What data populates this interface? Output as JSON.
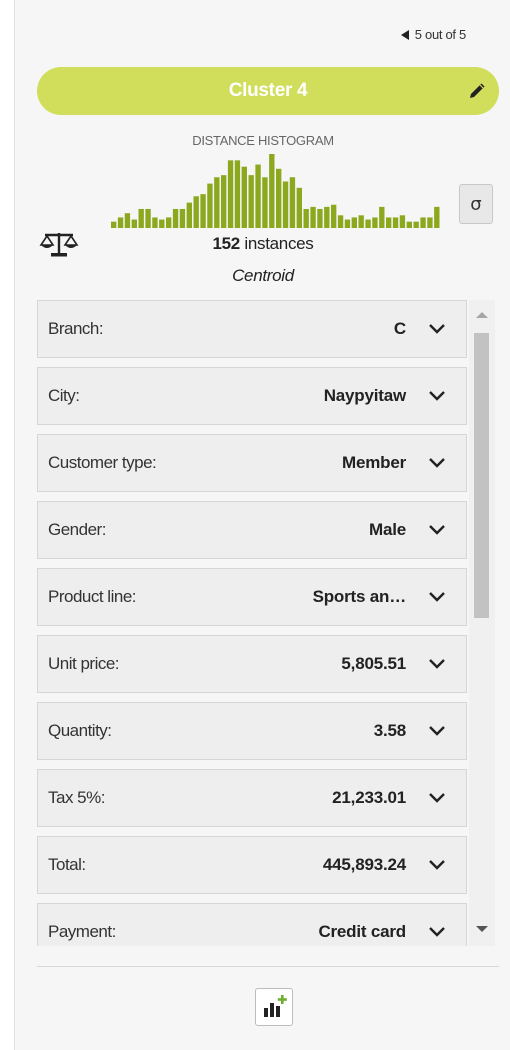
{
  "pager": {
    "text": "5 out of 5"
  },
  "cluster": {
    "title": "Cluster 4",
    "color": "#d0de5b"
  },
  "histogram": {
    "label": "DISTANCE HISTOGRAM",
    "bar_color": "#8ca81e",
    "bins": [
      3,
      5,
      7,
      4,
      9,
      9,
      5,
      4,
      5,
      9,
      9,
      12,
      15,
      16,
      21,
      24,
      25,
      32,
      32,
      29,
      25,
      30,
      24,
      35,
      28,
      22,
      24,
      19,
      9,
      10,
      9,
      10,
      11,
      6,
      4,
      5,
      6,
      4,
      5,
      10,
      5,
      5,
      6,
      3,
      3,
      5,
      5,
      10
    ]
  },
  "sigma": {
    "label": "σ"
  },
  "summary": {
    "count": "152",
    "instances_label": "instances",
    "subtitle": "Centroid"
  },
  "fields": [
    {
      "label": "Branch:",
      "value": "C"
    },
    {
      "label": "City:",
      "value": "Naypyitaw"
    },
    {
      "label": "Customer type:",
      "value": "Member"
    },
    {
      "label": "Gender:",
      "value": "Male"
    },
    {
      "label": "Product line:",
      "value": "Sports an…"
    },
    {
      "label": "Unit price:",
      "value": "5,805.51"
    },
    {
      "label": "Quantity:",
      "value": "3.58"
    },
    {
      "label": "Tax 5%:",
      "value": "21,233.01"
    },
    {
      "label": "Total:",
      "value": "445,893.24"
    },
    {
      "label": "Payment:",
      "value": "Credit card"
    }
  ],
  "footer": {
    "add_chart_icon": "bar-chart-plus-icon"
  }
}
